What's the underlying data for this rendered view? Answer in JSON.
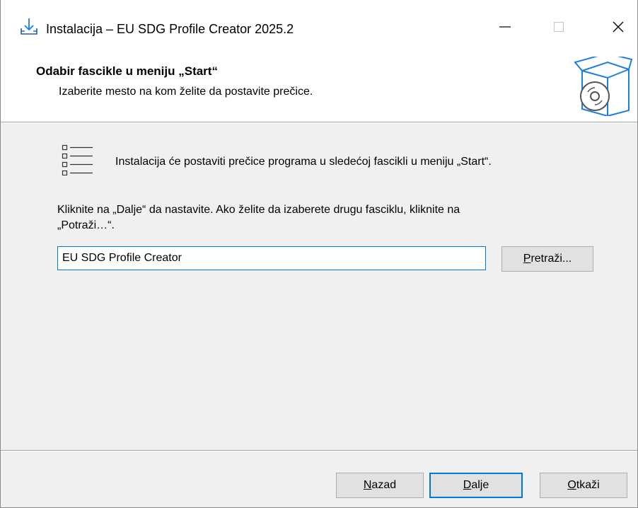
{
  "window": {
    "title": "Instalacija – EU SDG Profile Creator 2025.2",
    "app_icon": "install-download-icon"
  },
  "header": {
    "heading": "Odabir fascikle u meniju „Start“",
    "subheading": "Izaberite mesto na kom želite da postavite prečice.",
    "icon": "software-box-cd-icon"
  },
  "body": {
    "list_icon": "shortcut-list-icon",
    "info_text": "Instalacija će postaviti prečice programa u sledećoj fascikli u meniju „Start“.",
    "instruction_line1": "Kliknite na „Dalje“ da nastavite. Ako želite da izaberete drugu fasciklu, kliknite na",
    "instruction_line2": "„Potraži…“.",
    "folder_value": "EU SDG Profile Creator",
    "browse": {
      "accel": "P",
      "rest": "retraži..."
    }
  },
  "footer": {
    "back": {
      "accel": "N",
      "rest": "azad"
    },
    "next": {
      "accel": "D",
      "rest": "alje"
    },
    "cancel": {
      "accel": "O",
      "rest": "tkaži"
    }
  },
  "colors": {
    "accent": "#0078d7",
    "panel_bg": "#ffffff",
    "window_bg": "#f0f0f0",
    "button_bg": "#e1e1e1"
  }
}
